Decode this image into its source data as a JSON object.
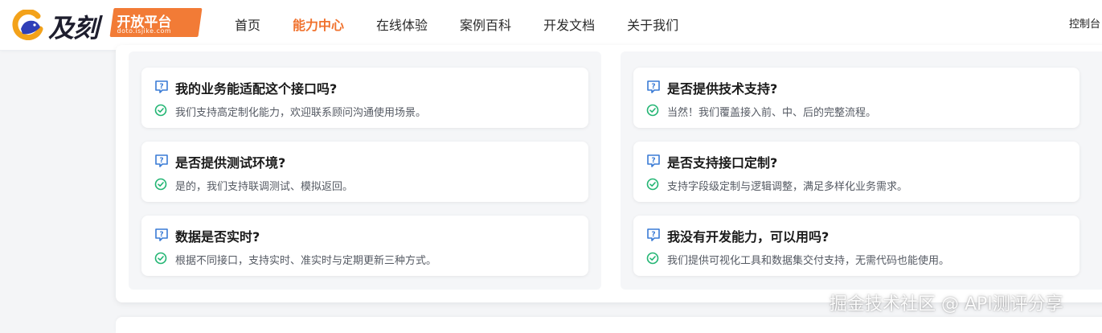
{
  "header": {
    "logo": {
      "wordmark": "及刻",
      "tagline": "开放平台",
      "domain": "doto.isjike.com"
    },
    "nav": [
      {
        "label": "首页",
        "active": false
      },
      {
        "label": "能力中心",
        "active": true
      },
      {
        "label": "在线体验",
        "active": false
      },
      {
        "label": "案例百科",
        "active": false
      },
      {
        "label": "开发文档",
        "active": false
      },
      {
        "label": "关于我们",
        "active": false
      }
    ],
    "console_label": "控制台"
  },
  "faq": {
    "left": [
      {
        "question": "我的业务能适配这个接口吗?",
        "answer": "我们支持高定制化能力，欢迎联系顾问沟通使用场景。"
      },
      {
        "question": "是否提供测试环境?",
        "answer": "是的，我们支持联调测试、模拟返回。"
      },
      {
        "question": "数据是否实时?",
        "answer": "根据不同接口，支持实时、准实时与定期更新三种方式。"
      }
    ],
    "right": [
      {
        "question": "是否提供技术支持?",
        "answer": "当然！我们覆盖接入前、中、后的完整流程。"
      },
      {
        "question": "是否支持接口定制?",
        "answer": "支持字段级定制与逻辑调整，满足多样化业务需求。"
      },
      {
        "question": "我没有开发能力，可以用吗?",
        "answer": "我们提供可视化工具和数据集交付支持，无需代码也能使用。"
      }
    ],
    "icons": {
      "question": "question-bubble-icon",
      "answer": "check-circle-icon"
    }
  },
  "watermark": "掘金技术社区 @ API测评分享",
  "colors": {
    "accent": "#f0722e",
    "logo_tag": "#f27b36",
    "question_icon": "#3a7bd5",
    "check_icon": "#22b573",
    "page_bg": "#f4f5f7"
  }
}
